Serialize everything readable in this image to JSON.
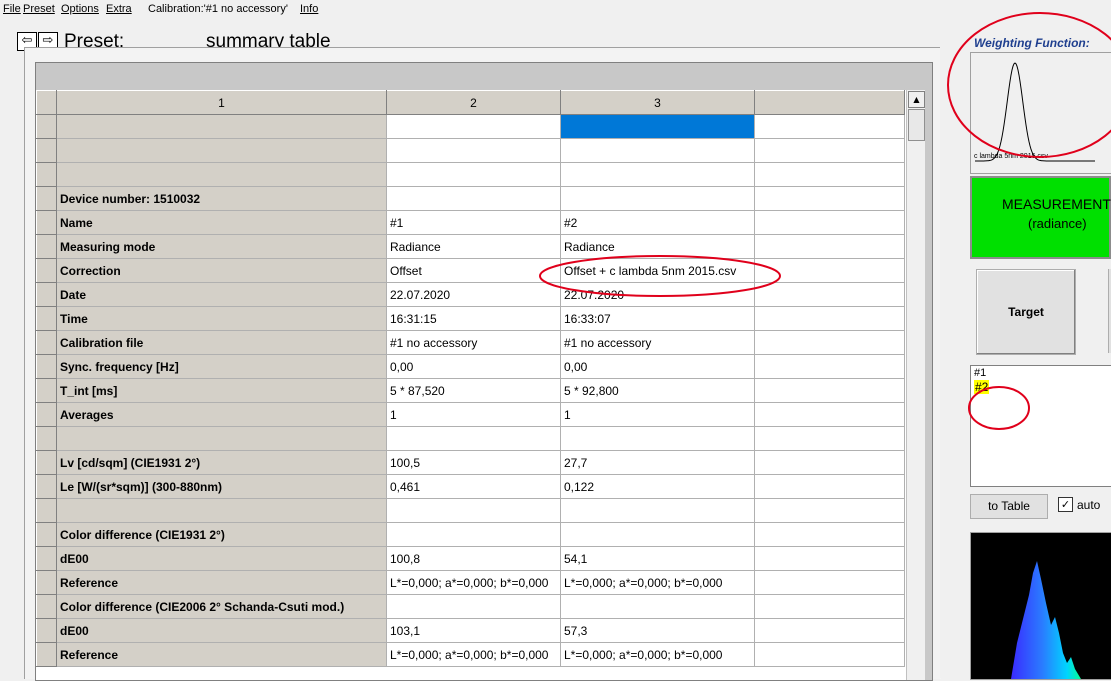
{
  "menu": {
    "file": "File",
    "preset": "Preset",
    "options": "Options",
    "extra": "Extra",
    "calibration": "Calibration:'#1 no accessory'",
    "info": "Info"
  },
  "header": {
    "back_icon": "arrow-left-icon",
    "forward_icon": "arrow-right-icon",
    "preset_label": "Preset:",
    "preset_value": "summary table"
  },
  "table": {
    "columns": [
      "1",
      "2",
      "3",
      ""
    ],
    "rows": [
      {
        "label": "",
        "c2": "",
        "c3": "",
        "selected3": true
      },
      {
        "label": "",
        "c2": "",
        "c3": ""
      },
      {
        "label": "",
        "c2": "",
        "c3": ""
      },
      {
        "label": "Device number: 1510032",
        "c2": "",
        "c3": ""
      },
      {
        "label": "Name",
        "c2": "#1",
        "c3": "#2"
      },
      {
        "label": "Measuring mode",
        "c2": "Radiance",
        "c3": "Radiance"
      },
      {
        "label": "Correction",
        "c2": "Offset",
        "c3": "Offset + c lambda 5nm 2015.csv"
      },
      {
        "label": "Date",
        "c2": "22.07.2020",
        "c3": "22.07.2020"
      },
      {
        "label": "Time",
        "c2": "16:31:15",
        "c3": "16:33:07"
      },
      {
        "label": "Calibration file",
        "c2": "#1 no accessory",
        "c3": "#1 no accessory"
      },
      {
        "label": "Sync. frequency [Hz]",
        "c2": "0,00",
        "c3": "0,00"
      },
      {
        "label": "T_int [ms]",
        "c2": "5 * 87,520",
        "c3": "5 * 92,800"
      },
      {
        "label": "Averages",
        "c2": "1",
        "c3": "1"
      },
      {
        "label": "",
        "c2": "",
        "c3": ""
      },
      {
        "label": "Lv [cd/sqm] (CIE1931 2°)",
        "c2": "100,5",
        "c3": "27,7"
      },
      {
        "label": "Le [W/(sr*sqm)] (300-880nm)",
        "c2": "0,461",
        "c3": "0,122"
      },
      {
        "label": "",
        "c2": "",
        "c3": ""
      },
      {
        "label": "Color difference (CIE1931 2°)",
        "c2": "",
        "c3": ""
      },
      {
        "label": "dE00",
        "c2": "100,8",
        "c3": "54,1"
      },
      {
        "label": "Reference",
        "c2": "L*=0,000; a*=0,000; b*=0,000",
        "c3": "L*=0,000; a*=0,000; b*=0,000"
      },
      {
        "label": "Color difference (CIE2006 2° Schanda-Csuti mod.)",
        "c2": "",
        "c3": ""
      },
      {
        "label": "dE00",
        "c2": "103,1",
        "c3": "57,3"
      },
      {
        "label": "Reference",
        "c2": "L*=0,000; a*=0,000; b*=0,000",
        "c3": "L*=0,000; a*=0,000; b*=0,000"
      }
    ]
  },
  "right_panel": {
    "weighting_title": "Weighting Function:",
    "weighting_file": "c lambda 5nm 2015.csv",
    "measurement_line1": "MEASUREMENT",
    "measurement_line2": "(radiance)",
    "target_label": "Target",
    "list_items": [
      "#1",
      "#2"
    ],
    "to_table_label": "to Table",
    "auto_label": "auto",
    "auto_checked": true
  },
  "colors": {
    "measure_bg": "#00e000",
    "selection": "#0078d7",
    "annotation": "#e0001b",
    "highlight": "#ffff00"
  }
}
